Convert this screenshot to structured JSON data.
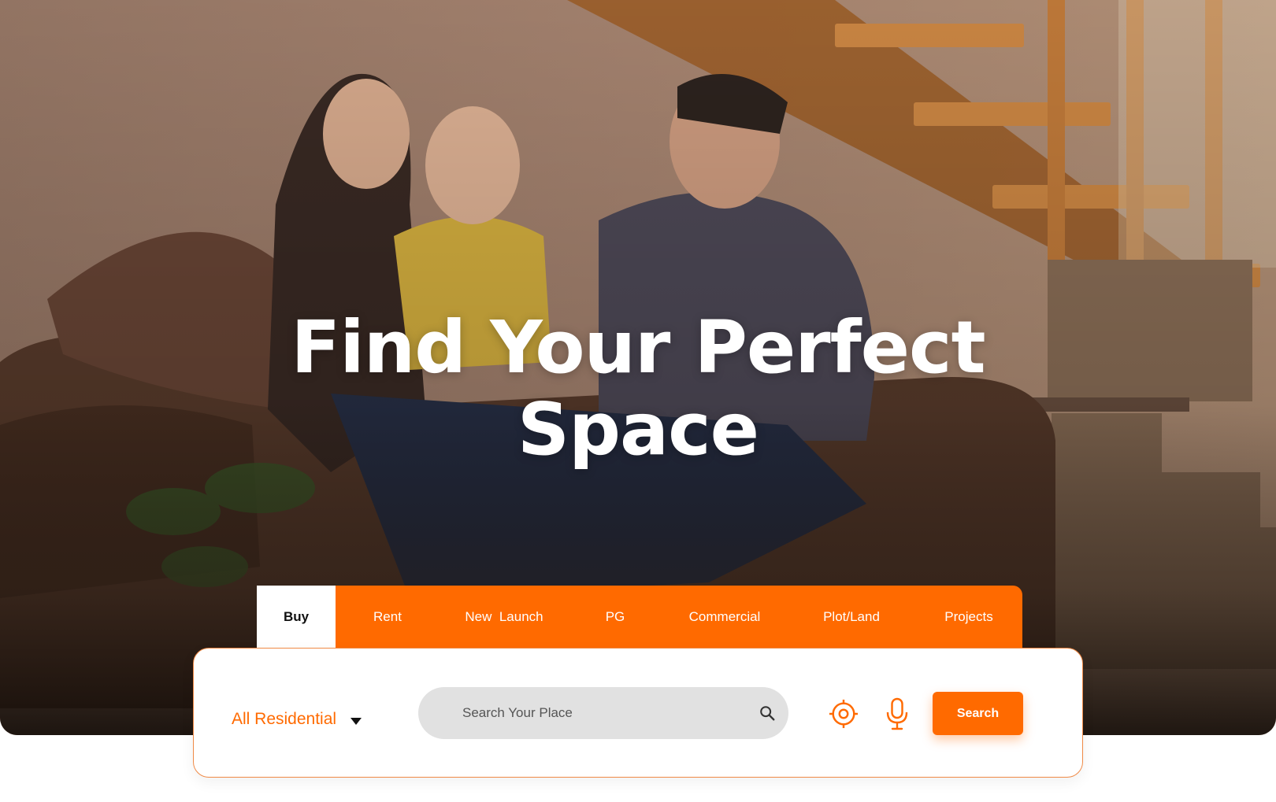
{
  "hero": {
    "title_line1": "Find Your Perfect",
    "title_line2": "Space",
    "image": "family-sitting-on-sofa-with-moving-boxes"
  },
  "tabs": [
    {
      "label": "Buy",
      "active": true
    },
    {
      "label": "Rent",
      "active": false
    },
    {
      "label": "New  Launch",
      "active": false
    },
    {
      "label": "PG",
      "active": false
    },
    {
      "label": "Commercial",
      "active": false
    },
    {
      "label": "Plot/Land",
      "active": false
    },
    {
      "label": "Projects",
      "active": false
    }
  ],
  "search": {
    "property_type": "All Residential",
    "placeholder": "Search Your Place",
    "button_label": "Search",
    "icons": [
      "search-icon",
      "locate-icon",
      "microphone-icon",
      "chevron-down-icon"
    ]
  },
  "colors": {
    "accent": "#ff6a00",
    "card_border": "#f08a46",
    "search_field_bg": "#e1e1e1",
    "hero_overlay_bottom": "#1a120d"
  }
}
